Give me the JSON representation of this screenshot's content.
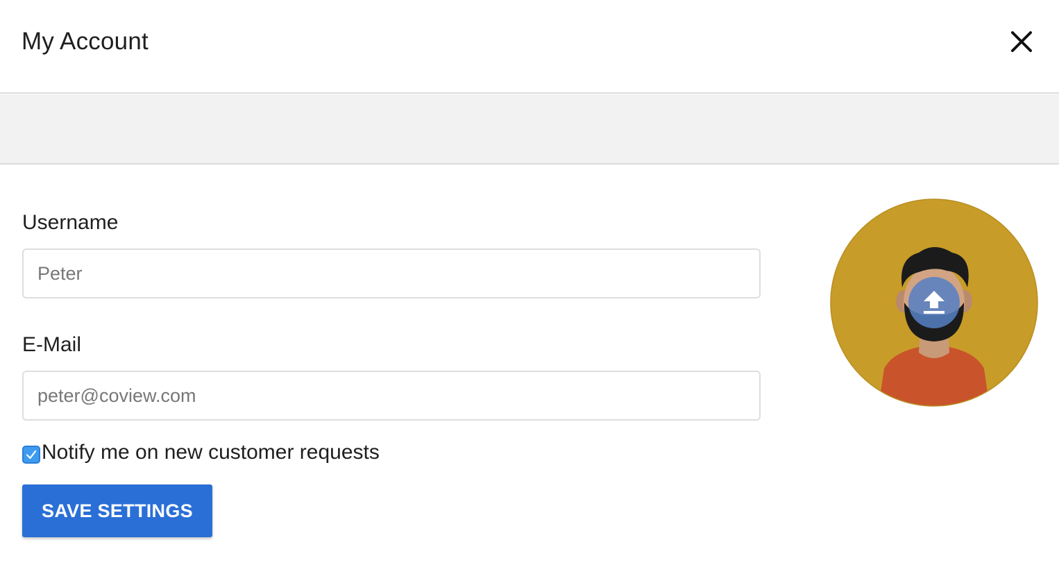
{
  "dialog": {
    "title": "My Account",
    "close_icon": "close-icon"
  },
  "form": {
    "username": {
      "label": "Username",
      "value": "Peter"
    },
    "email": {
      "label": "E-Mail",
      "value": "peter@coview.com"
    },
    "notify": {
      "label": "Notify me on new customer requests",
      "checked": true
    },
    "save_label": "SAVE SETTINGS"
  },
  "avatar": {
    "icon": "avatar",
    "upload_icon": "upload-icon"
  },
  "colors": {
    "accent": "#2a6fd6",
    "checkbox": "#3d9bf0",
    "avatar_bg": "#c89c28",
    "shirt": "#c9542b"
  }
}
